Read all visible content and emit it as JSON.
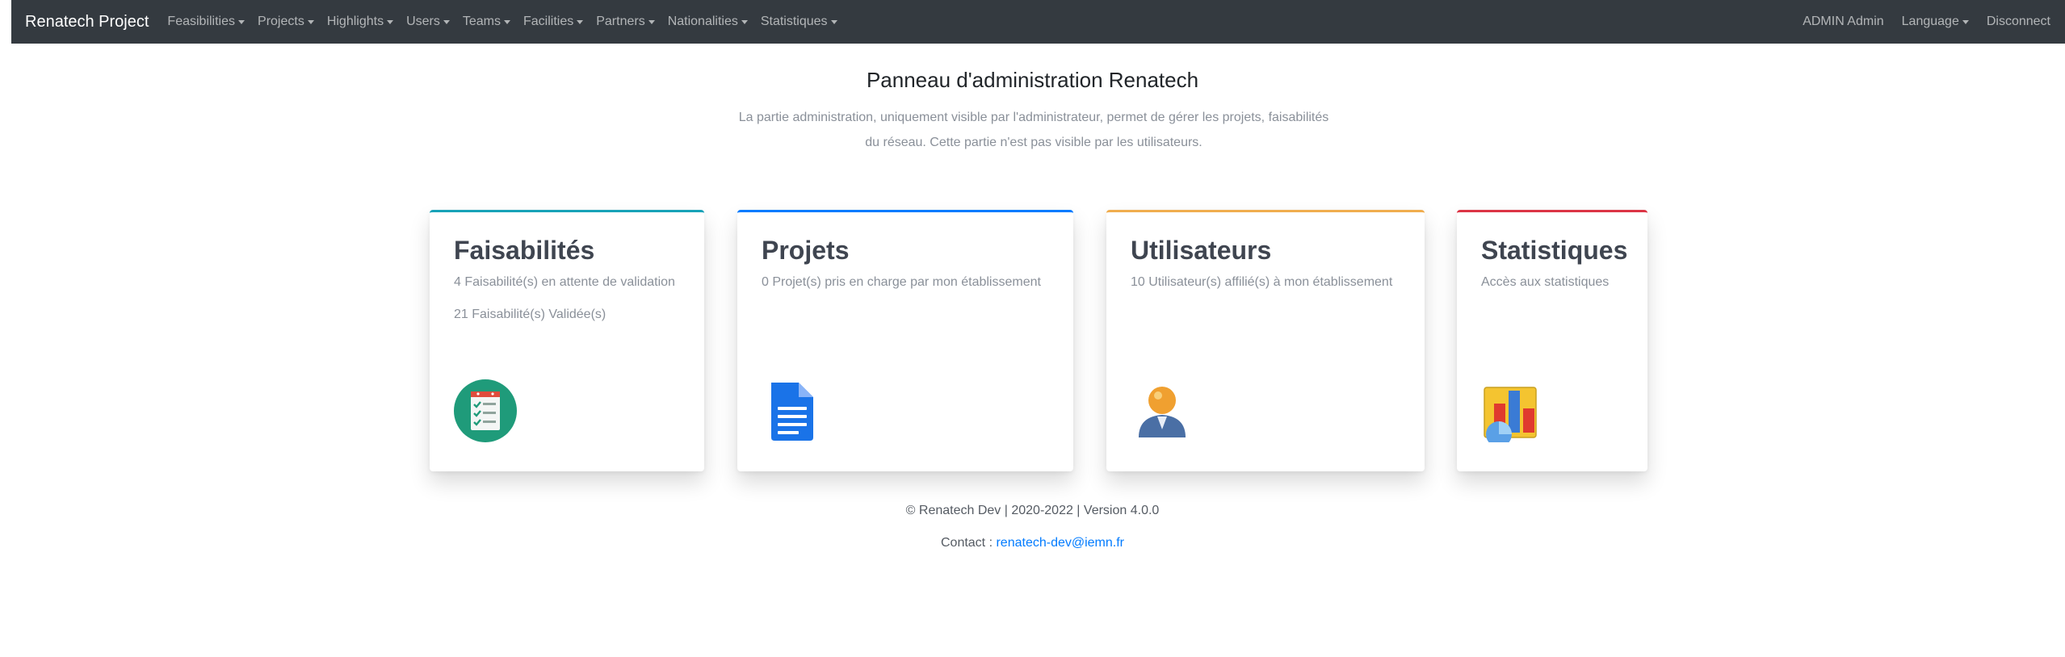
{
  "navbar": {
    "brand": "Renatech Project",
    "menus": [
      "Feasibilities",
      "Projects",
      "Highlights",
      "Users",
      "Teams",
      "Facilities",
      "Partners",
      "Nationalities",
      "Statistiques"
    ],
    "user": "ADMIN Admin",
    "language": "Language",
    "disconnect": "Disconnect"
  },
  "header": {
    "title": "Panneau d'administration Renatech",
    "lead_line1": "La partie administration, uniquement visible par l'administrateur, permet de gérer les projets, faisabilités",
    "lead_line2": "du réseau. Cette partie n'est pas visible par les utilisateurs."
  },
  "cards": [
    {
      "title": "Faisabilités",
      "text": "4 Faisabilité(s) en attente de validation",
      "text2": "21 Faisabilité(s) Validée(s)",
      "accent": "#17a2b8",
      "icon": "checklist-icon"
    },
    {
      "title": "Projets",
      "text": "0 Projet(s) pris en charge par mon établissement",
      "accent": "#007bff",
      "icon": "document-icon"
    },
    {
      "title": "Utilisateurs",
      "text": "10 Utilisateur(s) affilié(s) à mon établissement",
      "accent": "#f0ad4e",
      "icon": "user-icon"
    },
    {
      "title": "Statistiques",
      "text": "Accès aux statistiques",
      "accent": "#dc3545",
      "icon": "chart-icon"
    }
  ],
  "footer": {
    "copyright": "© Renatech Dev | 2020-2022 | Version 4.0.0",
    "contact_label": "Contact : ",
    "contact_email": "renatech-dev@iemn.fr"
  }
}
